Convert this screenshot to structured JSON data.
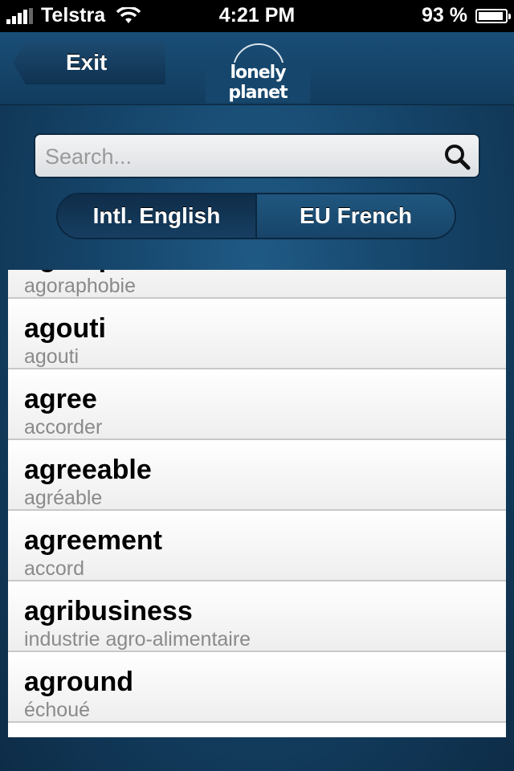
{
  "status_bar": {
    "carrier": "Telstra",
    "time": "4:21 PM",
    "battery_percent": "93 %",
    "battery_level": 0.93,
    "signal_bars": 4
  },
  "header": {
    "exit_label": "Exit",
    "logo_text": "lonely planet"
  },
  "search": {
    "placeholder": "Search...",
    "value": ""
  },
  "languages": {
    "source": "Intl. English",
    "target": "EU French",
    "active": "source"
  },
  "entries": [
    {
      "word": "agoraphobia",
      "translation": "agoraphobie"
    },
    {
      "word": "agouti",
      "translation": "agouti"
    },
    {
      "word": "agree",
      "translation": "accorder"
    },
    {
      "word": "agreeable",
      "translation": "agréable"
    },
    {
      "word": "agreement",
      "translation": "accord"
    },
    {
      "word": "agribusiness",
      "translation": "industrie agro-alimentaire"
    },
    {
      "word": "aground",
      "translation": "échoué"
    }
  ]
}
